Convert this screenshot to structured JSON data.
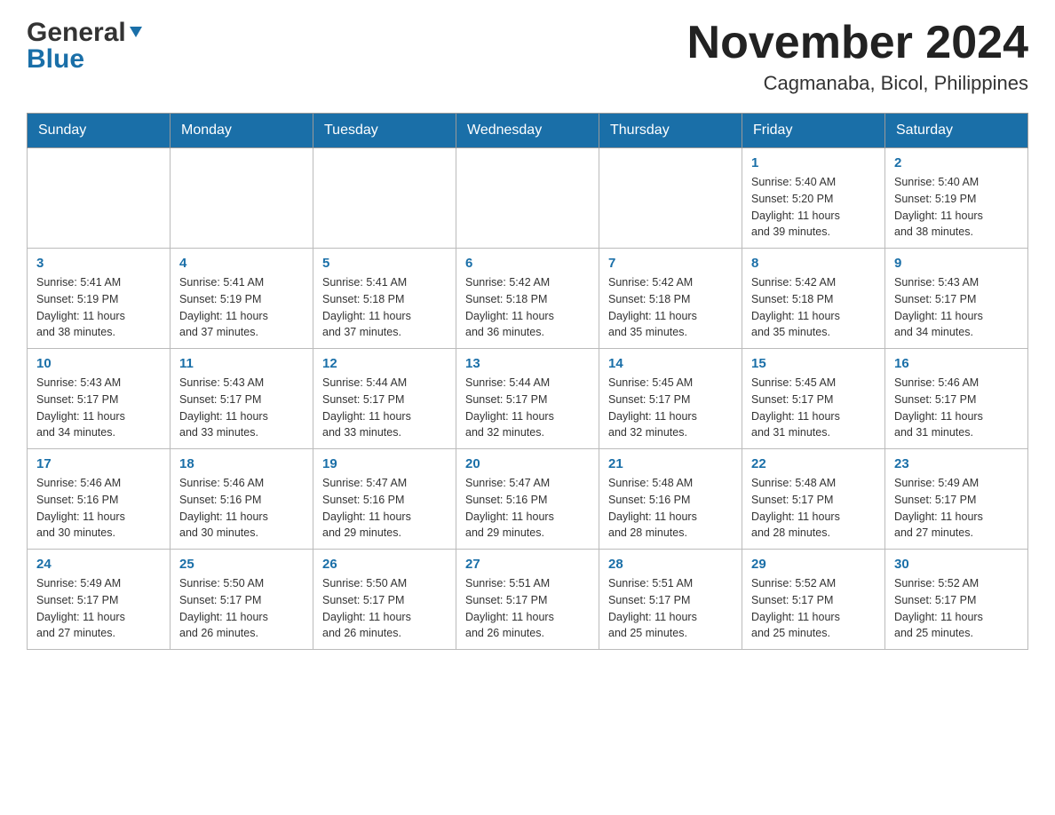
{
  "header": {
    "logo_general": "General",
    "logo_blue": "Blue",
    "month_title": "November 2024",
    "location": "Cagmanaba, Bicol, Philippines"
  },
  "weekdays": [
    "Sunday",
    "Monday",
    "Tuesday",
    "Wednesday",
    "Thursday",
    "Friday",
    "Saturday"
  ],
  "rows": [
    {
      "cells": [
        {
          "day": "",
          "info": ""
        },
        {
          "day": "",
          "info": ""
        },
        {
          "day": "",
          "info": ""
        },
        {
          "day": "",
          "info": ""
        },
        {
          "day": "",
          "info": ""
        },
        {
          "day": "1",
          "info": "Sunrise: 5:40 AM\nSunset: 5:20 PM\nDaylight: 11 hours\nand 39 minutes."
        },
        {
          "day": "2",
          "info": "Sunrise: 5:40 AM\nSunset: 5:19 PM\nDaylight: 11 hours\nand 38 minutes."
        }
      ]
    },
    {
      "cells": [
        {
          "day": "3",
          "info": "Sunrise: 5:41 AM\nSunset: 5:19 PM\nDaylight: 11 hours\nand 38 minutes."
        },
        {
          "day": "4",
          "info": "Sunrise: 5:41 AM\nSunset: 5:19 PM\nDaylight: 11 hours\nand 37 minutes."
        },
        {
          "day": "5",
          "info": "Sunrise: 5:41 AM\nSunset: 5:18 PM\nDaylight: 11 hours\nand 37 minutes."
        },
        {
          "day": "6",
          "info": "Sunrise: 5:42 AM\nSunset: 5:18 PM\nDaylight: 11 hours\nand 36 minutes."
        },
        {
          "day": "7",
          "info": "Sunrise: 5:42 AM\nSunset: 5:18 PM\nDaylight: 11 hours\nand 35 minutes."
        },
        {
          "day": "8",
          "info": "Sunrise: 5:42 AM\nSunset: 5:18 PM\nDaylight: 11 hours\nand 35 minutes."
        },
        {
          "day": "9",
          "info": "Sunrise: 5:43 AM\nSunset: 5:17 PM\nDaylight: 11 hours\nand 34 minutes."
        }
      ]
    },
    {
      "cells": [
        {
          "day": "10",
          "info": "Sunrise: 5:43 AM\nSunset: 5:17 PM\nDaylight: 11 hours\nand 34 minutes."
        },
        {
          "day": "11",
          "info": "Sunrise: 5:43 AM\nSunset: 5:17 PM\nDaylight: 11 hours\nand 33 minutes."
        },
        {
          "day": "12",
          "info": "Sunrise: 5:44 AM\nSunset: 5:17 PM\nDaylight: 11 hours\nand 33 minutes."
        },
        {
          "day": "13",
          "info": "Sunrise: 5:44 AM\nSunset: 5:17 PM\nDaylight: 11 hours\nand 32 minutes."
        },
        {
          "day": "14",
          "info": "Sunrise: 5:45 AM\nSunset: 5:17 PM\nDaylight: 11 hours\nand 32 minutes."
        },
        {
          "day": "15",
          "info": "Sunrise: 5:45 AM\nSunset: 5:17 PM\nDaylight: 11 hours\nand 31 minutes."
        },
        {
          "day": "16",
          "info": "Sunrise: 5:46 AM\nSunset: 5:17 PM\nDaylight: 11 hours\nand 31 minutes."
        }
      ]
    },
    {
      "cells": [
        {
          "day": "17",
          "info": "Sunrise: 5:46 AM\nSunset: 5:16 PM\nDaylight: 11 hours\nand 30 minutes."
        },
        {
          "day": "18",
          "info": "Sunrise: 5:46 AM\nSunset: 5:16 PM\nDaylight: 11 hours\nand 30 minutes."
        },
        {
          "day": "19",
          "info": "Sunrise: 5:47 AM\nSunset: 5:16 PM\nDaylight: 11 hours\nand 29 minutes."
        },
        {
          "day": "20",
          "info": "Sunrise: 5:47 AM\nSunset: 5:16 PM\nDaylight: 11 hours\nand 29 minutes."
        },
        {
          "day": "21",
          "info": "Sunrise: 5:48 AM\nSunset: 5:16 PM\nDaylight: 11 hours\nand 28 minutes."
        },
        {
          "day": "22",
          "info": "Sunrise: 5:48 AM\nSunset: 5:17 PM\nDaylight: 11 hours\nand 28 minutes."
        },
        {
          "day": "23",
          "info": "Sunrise: 5:49 AM\nSunset: 5:17 PM\nDaylight: 11 hours\nand 27 minutes."
        }
      ]
    },
    {
      "cells": [
        {
          "day": "24",
          "info": "Sunrise: 5:49 AM\nSunset: 5:17 PM\nDaylight: 11 hours\nand 27 minutes."
        },
        {
          "day": "25",
          "info": "Sunrise: 5:50 AM\nSunset: 5:17 PM\nDaylight: 11 hours\nand 26 minutes."
        },
        {
          "day": "26",
          "info": "Sunrise: 5:50 AM\nSunset: 5:17 PM\nDaylight: 11 hours\nand 26 minutes."
        },
        {
          "day": "27",
          "info": "Sunrise: 5:51 AM\nSunset: 5:17 PM\nDaylight: 11 hours\nand 26 minutes."
        },
        {
          "day": "28",
          "info": "Sunrise: 5:51 AM\nSunset: 5:17 PM\nDaylight: 11 hours\nand 25 minutes."
        },
        {
          "day": "29",
          "info": "Sunrise: 5:52 AM\nSunset: 5:17 PM\nDaylight: 11 hours\nand 25 minutes."
        },
        {
          "day": "30",
          "info": "Sunrise: 5:52 AM\nSunset: 5:17 PM\nDaylight: 11 hours\nand 25 minutes."
        }
      ]
    }
  ]
}
